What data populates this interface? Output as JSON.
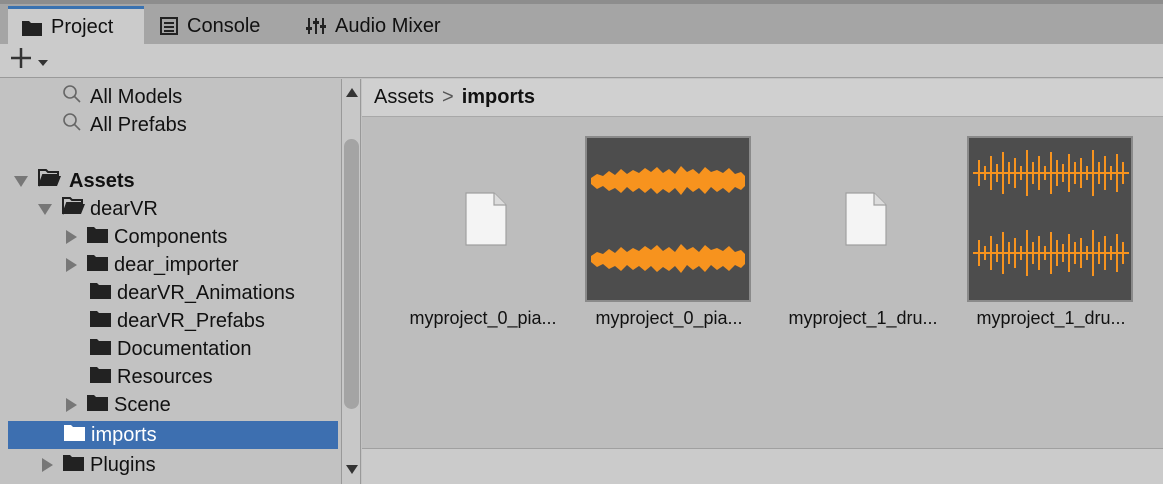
{
  "tabs": [
    {
      "label": "Project",
      "icon": "folder-icon",
      "active": true
    },
    {
      "label": "Console",
      "icon": "console-icon",
      "active": false
    },
    {
      "label": "Audio Mixer",
      "icon": "mixer-icon",
      "active": false
    }
  ],
  "toolbar": {
    "create_label": "+",
    "create_icon": "plus-icon"
  },
  "tree": {
    "favorites": [
      {
        "label": "All Models",
        "icon": "search-icon"
      },
      {
        "label": "All Prefabs",
        "icon": "search-icon"
      }
    ],
    "assets_label": "Assets",
    "dearvr_label": "dearVR",
    "dearvr_children": [
      {
        "label": "Components",
        "expandable": true
      },
      {
        "label": "dear_importer",
        "expandable": true
      },
      {
        "label": "dearVR_Animations",
        "expandable": false
      },
      {
        "label": "dearVR_Prefabs",
        "expandable": false
      },
      {
        "label": "Documentation",
        "expandable": false
      },
      {
        "label": "Resources",
        "expandable": false
      },
      {
        "label": "Scene",
        "expandable": true
      }
    ],
    "imports_label": "imports",
    "plugins_label": "Plugins"
  },
  "breadcrumb": {
    "root": "Assets",
    "separator": ">",
    "current": "imports"
  },
  "assets": [
    {
      "name": "myproject_0_pia...",
      "kind": "file"
    },
    {
      "name": "myproject_0_pia...",
      "kind": "audio-piano"
    },
    {
      "name": "myproject_1_dru...",
      "kind": "file"
    },
    {
      "name": "myproject_1_dru...",
      "kind": "audio-drums"
    }
  ],
  "colors": {
    "selection": "#3d6fb0",
    "waveform": "#f7931e",
    "tab_accent": "#3a72b0"
  }
}
